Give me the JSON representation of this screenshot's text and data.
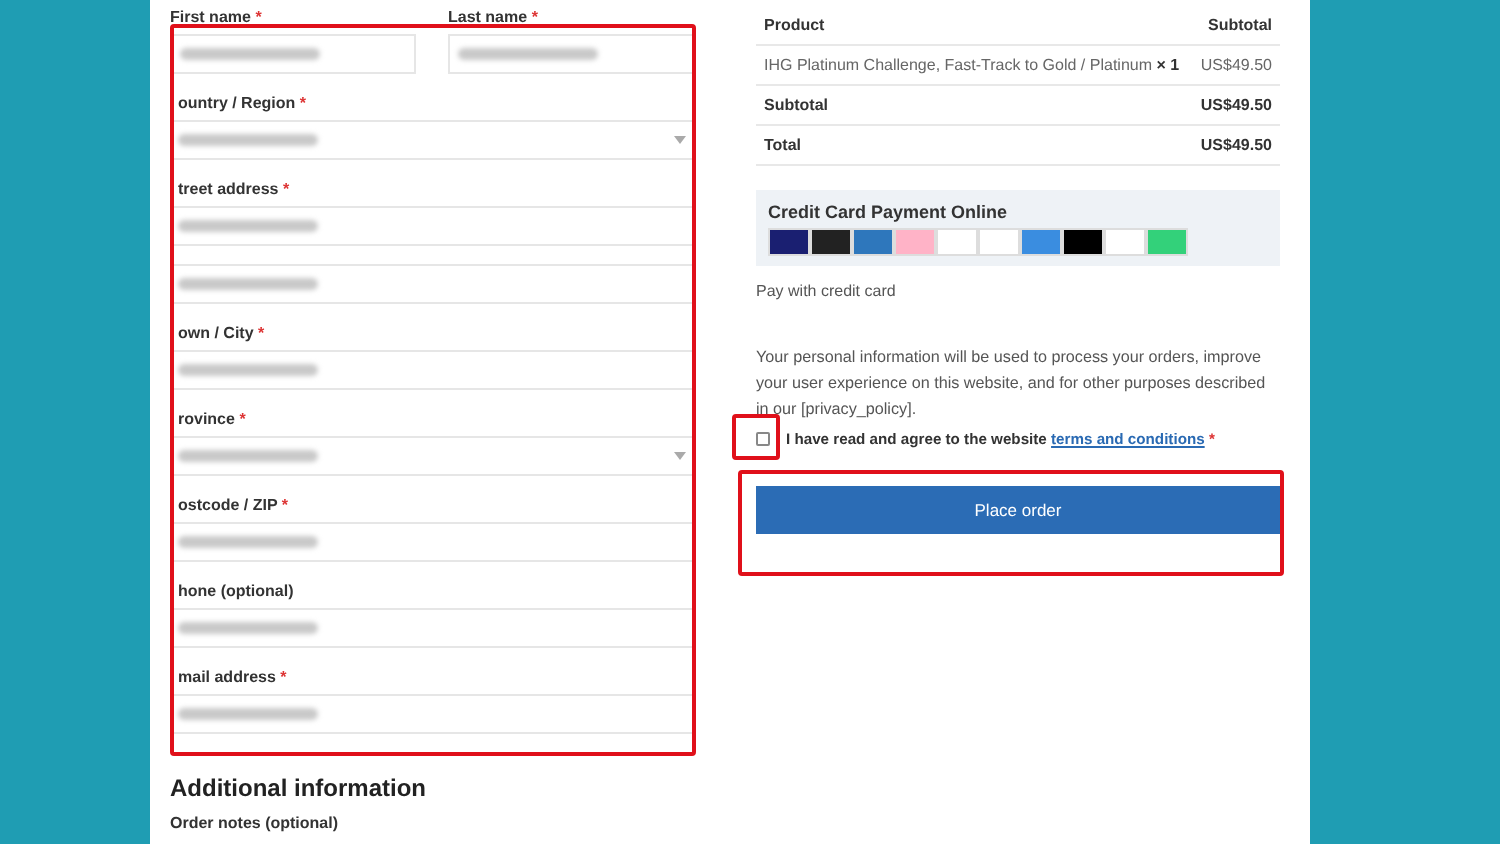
{
  "billing": {
    "name_fields": [
      {
        "label": "First name",
        "mark": "*",
        "blurred": true
      },
      {
        "label": "Last name",
        "mark": "*",
        "blurred": true
      }
    ],
    "fields": [
      {
        "label": "ountry / Region",
        "mark": "*",
        "kind": "select",
        "blurred": true
      },
      {
        "label": "treet address",
        "mark": "*",
        "kind": "text",
        "blurred": true
      },
      {
        "kind": "text",
        "blurred": true
      },
      {
        "label": "own / City",
        "mark": "*",
        "kind": "text",
        "blurred": true
      },
      {
        "label": "rovince",
        "mark": "*",
        "kind": "select",
        "blurred": true
      },
      {
        "label": "ostcode / ZIP",
        "mark": "*",
        "kind": "text",
        "blurred": true
      },
      {
        "label": "hone (optional)",
        "kind": "text",
        "blurred": true
      },
      {
        "label": "mail address",
        "mark": "*",
        "kind": "text",
        "blurred": true
      }
    ]
  },
  "additional": {
    "heading": "Additional information",
    "notes_label": "Order notes (optional)"
  },
  "order": {
    "columns": [
      "Product",
      "Subtotal"
    ],
    "item": {
      "name": "IHG Platinum Challenge, Fast-Track to Gold / Platinum",
      "qty": "× 1",
      "price": "US$49.50"
    },
    "totals": [
      {
        "label": "Subtotal",
        "value": "US$49.50"
      },
      {
        "label": "Total",
        "value": "US$49.50"
      }
    ]
  },
  "payment": {
    "title": "Credit Card Payment Online",
    "description": "Pay with credit card"
  },
  "privacy": "Your personal information will be used to process your orders, improve your user experience on this website, and for other purposes described in our [privacy_policy].",
  "terms": {
    "text": "I have read and agree to the website",
    "link": "terms and conditions",
    "checked": false,
    "mark": "*"
  },
  "place_order": "Place order"
}
